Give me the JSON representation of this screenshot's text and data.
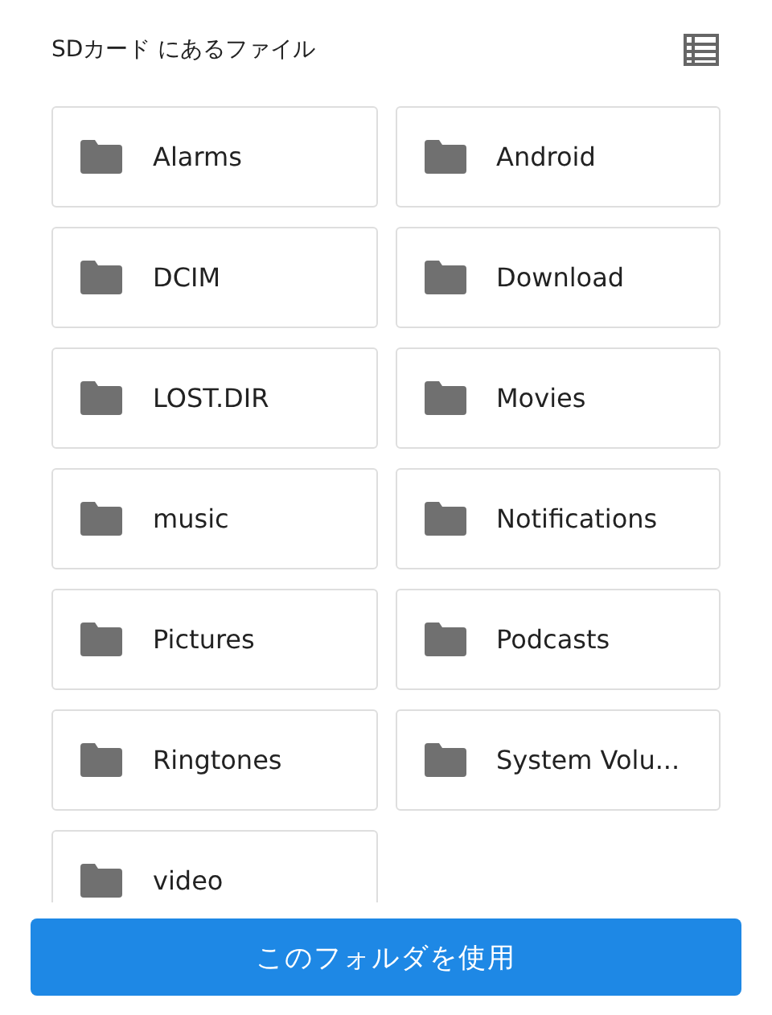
{
  "header": {
    "title": "SDカード にあるファイル"
  },
  "folders": [
    {
      "name": "Alarms"
    },
    {
      "name": "Android"
    },
    {
      "name": "DCIM"
    },
    {
      "name": "Download"
    },
    {
      "name": "LOST.DIR"
    },
    {
      "name": "Movies"
    },
    {
      "name": "music"
    },
    {
      "name": "Notifications"
    },
    {
      "name": "Pictures"
    },
    {
      "name": "Podcasts"
    },
    {
      "name": "Ringtones"
    },
    {
      "name": "System Volu..."
    },
    {
      "name": "video"
    }
  ],
  "action_button": {
    "label": "このフォルダを使用"
  }
}
